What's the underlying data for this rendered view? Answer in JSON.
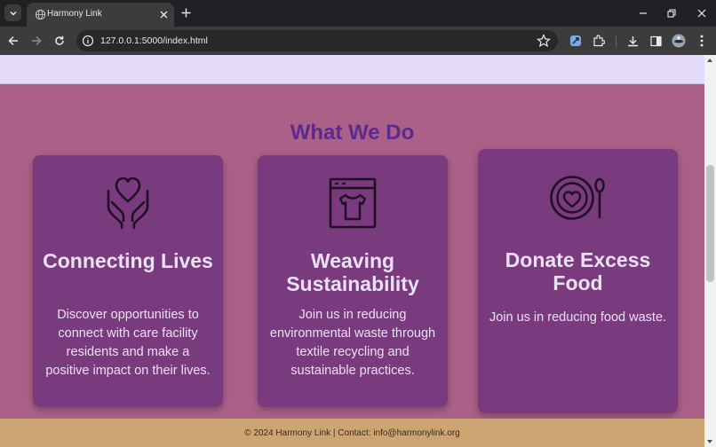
{
  "browser": {
    "tab_title": "Harmony Link",
    "url": "127.0.0.1:5000/index.html"
  },
  "page": {
    "section_title": "What We Do",
    "cards": [
      {
        "icon": "hands-heart-icon",
        "title": "Connecting Lives",
        "description": "Discover opportunities to connect with care facility residents and make a positive impact on their lives."
      },
      {
        "icon": "tshirt-frame-icon",
        "title": "Weaving Sustainability",
        "description": "Join us in reducing environmental waste through textile recycling and sustainable practices."
      },
      {
        "icon": "plate-heart-spoon-icon",
        "title": "Donate Excess Food",
        "description": "Join us in reducing food waste."
      }
    ],
    "footer_text": "© 2024 Harmony Link | Contact: info@harmonylink.org"
  },
  "colors": {
    "page_background": "#ab6088",
    "top_band": "#e4dcfa",
    "card_background": "#7a3a7e",
    "title_color": "#5b2a8f",
    "footer_background": "#cda572"
  }
}
